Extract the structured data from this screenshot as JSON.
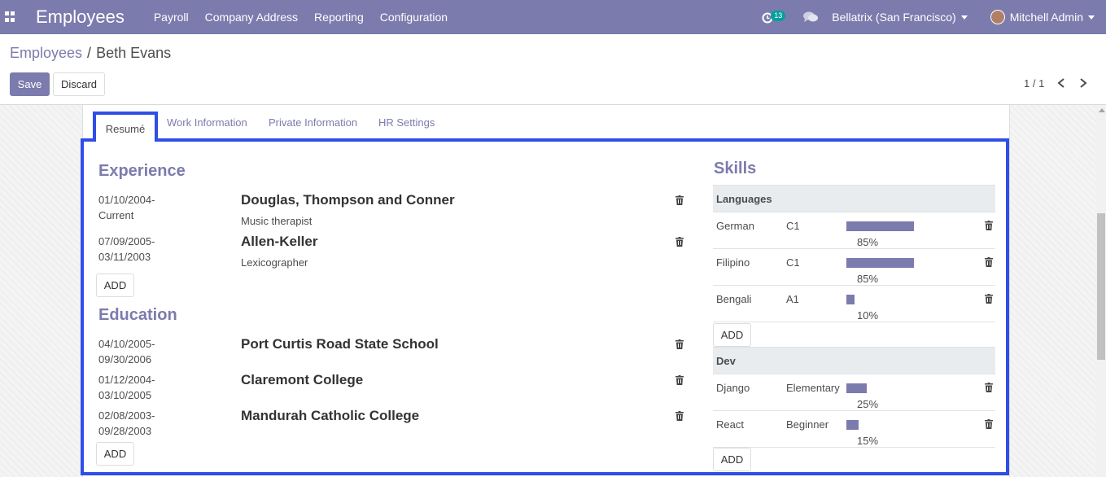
{
  "navbar": {
    "app_name": "Employees",
    "menu": [
      "Payroll",
      "Company Address",
      "Reporting",
      "Configuration"
    ],
    "activity_count": "13",
    "company": "Bellatrix (San Francisco)",
    "user": "Mitchell Admin"
  },
  "breadcrumb": {
    "parent": "Employees",
    "separator": "/",
    "current": "Beth Evans"
  },
  "buttons": {
    "save": "Save",
    "discard": "Discard",
    "add": "ADD"
  },
  "pager": {
    "value": "1 / 1"
  },
  "tabs": [
    "Resumé",
    "Work Information",
    "Private Information",
    "HR Settings"
  ],
  "resume": {
    "experience_title": "Experience",
    "education_title": "Education",
    "experience": [
      {
        "date_start": "01/10/2004-",
        "date_end": "Current",
        "name": "Douglas, Thompson and Conner",
        "description": "Music therapist"
      },
      {
        "date_start": "07/09/2005-",
        "date_end": "03/11/2003",
        "name": "Allen-Keller",
        "description": "Lexicographer"
      }
    ],
    "education": [
      {
        "date_start": "04/10/2005-",
        "date_end": "09/30/2006",
        "name": "Port Curtis Road State School"
      },
      {
        "date_start": "01/12/2004-",
        "date_end": "03/10/2005",
        "name": "Claremont College"
      },
      {
        "date_start": "02/08/2003-",
        "date_end": "09/28/2003",
        "name": "Mandurah Catholic College"
      }
    ]
  },
  "skills": {
    "title": "Skills",
    "groups": [
      {
        "name": "Languages",
        "items": [
          {
            "skill": "German",
            "level": "C1",
            "progress": 0.85,
            "progress_label": "85%"
          },
          {
            "skill": "Filipino",
            "level": "C1",
            "progress": 0.85,
            "progress_label": "85%"
          },
          {
            "skill": "Bengali",
            "level": "A1",
            "progress": 0.1,
            "progress_label": "10%"
          }
        ]
      },
      {
        "name": "Dev",
        "items": [
          {
            "skill": "Django",
            "level": "Elementary",
            "progress": 0.25,
            "progress_label": "25%"
          },
          {
            "skill": "React",
            "level": "Beginner",
            "progress": 0.15,
            "progress_label": "15%"
          }
        ]
      }
    ]
  },
  "colors": {
    "brand": "#7c7bad",
    "highlight": "#2e4ee6",
    "badge": "#00a09d"
  },
  "icons": {
    "apps": "apps-grid-icon",
    "activity": "clock-icon",
    "chat": "chat-bubbles-icon",
    "delete": "trash-icon",
    "prev": "chevron-left-icon",
    "next": "chevron-right-icon"
  }
}
